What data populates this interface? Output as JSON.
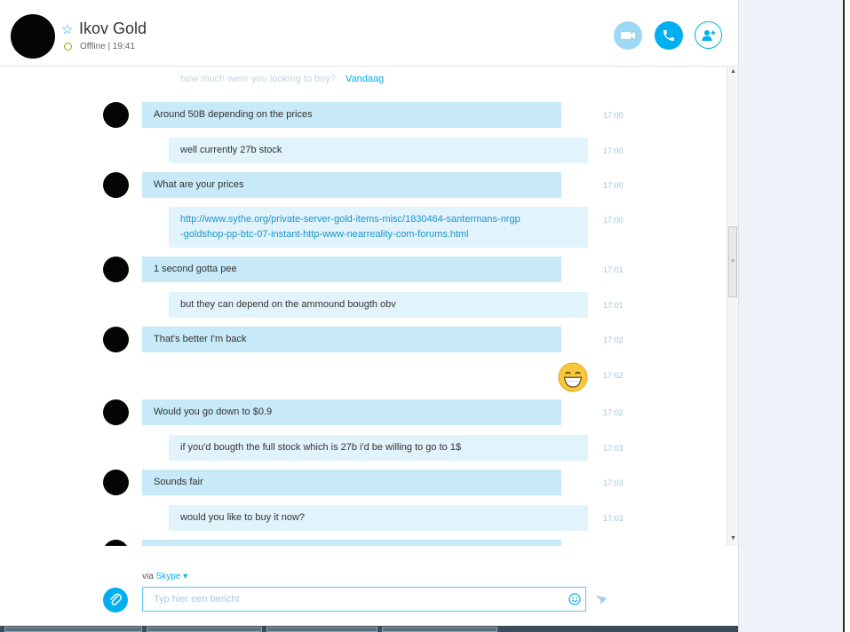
{
  "header": {
    "contact_name": "Ikov Gold",
    "status": "Offline | 19:41"
  },
  "chat": {
    "faded_text": "how much were you looking to buy?",
    "day_label": "Vandaag",
    "messages": [
      {
        "text": "Around 50B depending on the prices",
        "time": "17:00"
      },
      {
        "text": "well currently 27b stock",
        "time": "17:00"
      },
      {
        "text": "What are your prices",
        "time": "17:00"
      },
      {
        "link_line1": "http://www.sythe.org/private-server-gold-items-misc/1830464-santermans-nrgp",
        "link_line2": "-goldshop-pp-btc-07-instant-http-www-nearreality-com-forums.html",
        "time": "17:00"
      },
      {
        "text": "1 second gotta pee",
        "time": "17:01"
      },
      {
        "text": "but they can depend on the ammound bougth obv",
        "time": "17:01"
      },
      {
        "text": "That's better I'm back",
        "time": "17:02"
      },
      {
        "emoji": "grinning-face",
        "time": "17:02"
      },
      {
        "text": "Would you go down to $0.9",
        "time": "17:02"
      },
      {
        "text": "if you'd bougth the full stock which is 27b i'd be willing to go to 1$",
        "time": "17:03"
      },
      {
        "text": "Sounds fair",
        "time": "17:03"
      },
      {
        "text": "would you like to buy it now?",
        "time": "17:03"
      }
    ]
  },
  "compose": {
    "via_label": "via",
    "via_service": "Skype",
    "placeholder": "Typ hier een bericht"
  },
  "colors": {
    "accent": "#00aff0",
    "bubble_contact": "#c7e9f8",
    "bubble_self": "#e1f3fb"
  },
  "icons": [
    "star-icon",
    "video-icon",
    "phone-icon",
    "add-contact-icon",
    "paperclip-icon",
    "smiley-icon",
    "send-icon",
    "chevron-down-icon"
  ]
}
